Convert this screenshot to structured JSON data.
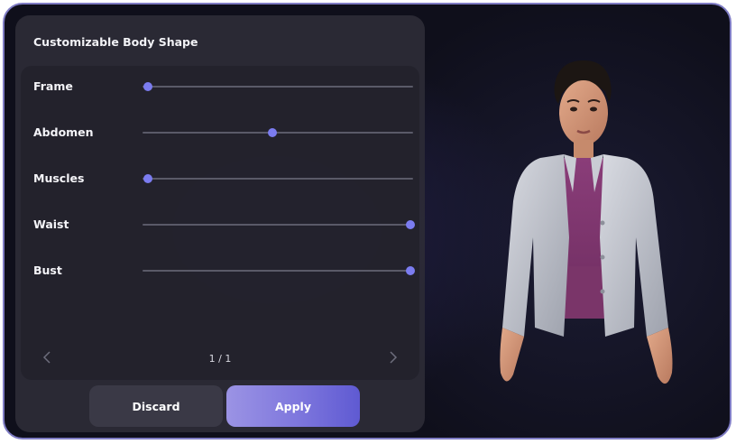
{
  "panel": {
    "title": "Customizable Body Shape",
    "sliders": [
      {
        "label": "Frame",
        "value": 0.02
      },
      {
        "label": "Abdomen",
        "value": 0.48
      },
      {
        "label": "Muscles",
        "value": 0.02
      },
      {
        "label": "Waist",
        "value": 0.99
      },
      {
        "label": "Bust",
        "value": 0.99
      }
    ],
    "pager": {
      "text": "1 / 1",
      "prev_icon": "chevron-left-icon",
      "next_icon": "chevron-right-icon"
    }
  },
  "buttons": {
    "discard": "Discard",
    "apply": "Apply"
  },
  "colors": {
    "accent": "#7b7cf0",
    "border": "#7f7cc4",
    "apply_start": "#9b93e4",
    "apply_end": "#5f5ad2"
  },
  "preview": {
    "subject": "3d-avatar-preview"
  }
}
